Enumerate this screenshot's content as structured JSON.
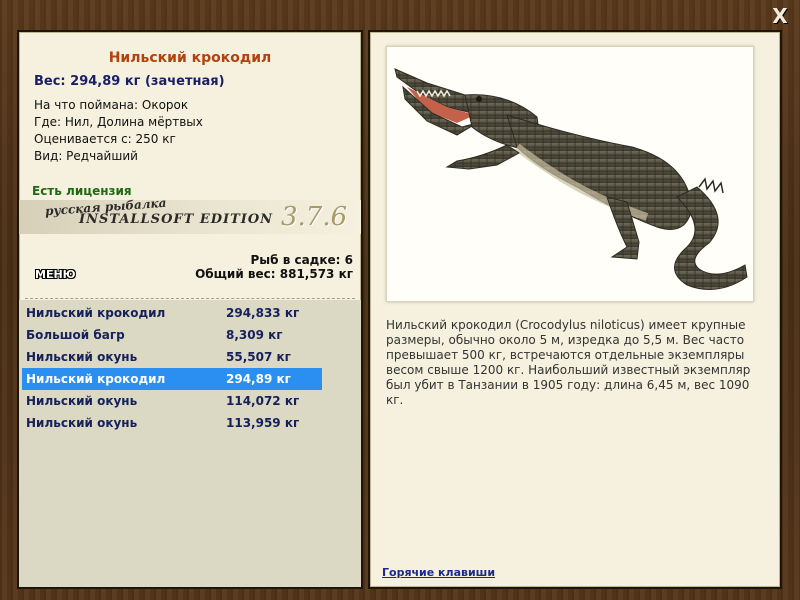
{
  "close_label": "X",
  "fish": {
    "title": "Нильский крокодил",
    "weight_line": "Вес: 294,89 кг (зачетная)",
    "caught_on": "На что поймана: Окорок",
    "where": "Где: Нил, Долина мёртвых",
    "valued_from": "Оценивается с: 250 кг",
    "kind": "Вид: Редчайший"
  },
  "license": "Есть лицензия",
  "banner": {
    "line1": "русская рыбалка",
    "line2": "INSTALLSOFT EDITION",
    "version": "3.7.6"
  },
  "menu_label": "МЕНЮ",
  "stats": {
    "count": "Рыб в садке: 6",
    "total": "Общий вес: 881,573 кг"
  },
  "catch": [
    {
      "name": "Нильский крокодил",
      "weight": "294,833 кг"
    },
    {
      "name": "Большой багр",
      "weight": "8,309 кг"
    },
    {
      "name": "Нильский окунь",
      "weight": "55,507 кг"
    },
    {
      "name": "Нильский крокодил",
      "weight": "294,89 кг"
    },
    {
      "name": "Нильский окунь",
      "weight": "114,072 кг"
    },
    {
      "name": "Нильский окунь",
      "weight": "113,959 кг"
    }
  ],
  "selected_index": 3,
  "description": "Нильский крокодил (Crocodylus niloticus) имеет крупные размеры, обычно около 5 м, изредка до 5,5 м. Вес часто превышает 500 кг, встречаются отдельные экземпляры весом свыше 1200 кг. Наибольший известный экземпляр был убит в Танзании в 1905 году: длина 6,45 м, вес 1090 кг.",
  "hotkeys_label": "Горячие клавиши",
  "colors": {
    "selection": "#2b8ff1",
    "title": "#b2420e",
    "license": "#1e6a12",
    "list_text": "#15205c"
  }
}
